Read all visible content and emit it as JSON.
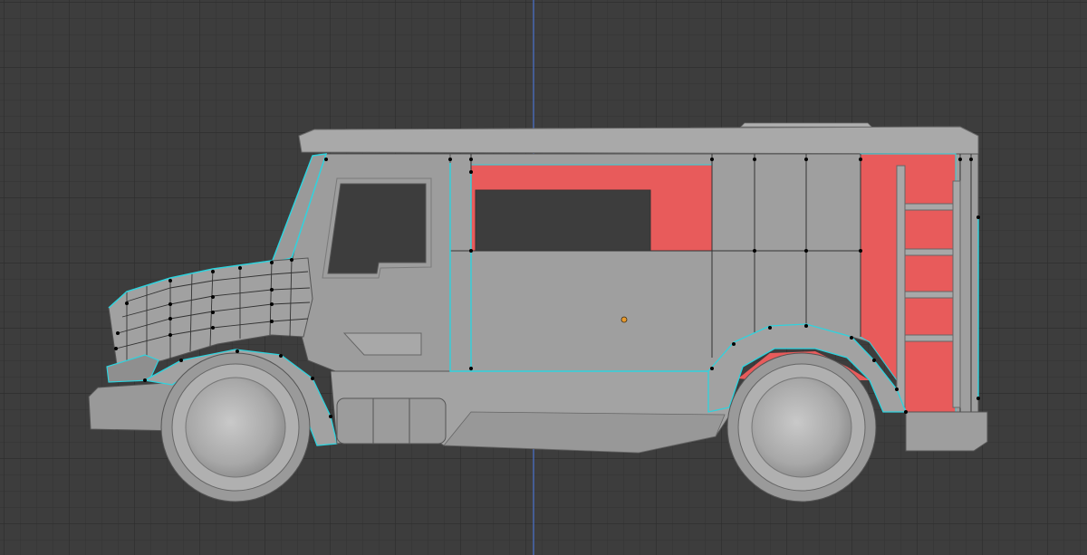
{
  "viewport": {
    "mode": "edit-mode",
    "view": "orthographic-side",
    "object": "truck-mesh",
    "colors": {
      "background": "#3d3d3d",
      "grid_minor": "#363636",
      "grid_major": "#2f2f2f",
      "z_axis": "#4a6fc4",
      "body": "#9c9c9c",
      "body_light": "#ababab",
      "body_dark": "#7d7d7d",
      "selected_face": "#e85b5b",
      "selected_edge": "#2fd3de",
      "vertex": "#000000",
      "origin": "#e89a2e"
    }
  }
}
